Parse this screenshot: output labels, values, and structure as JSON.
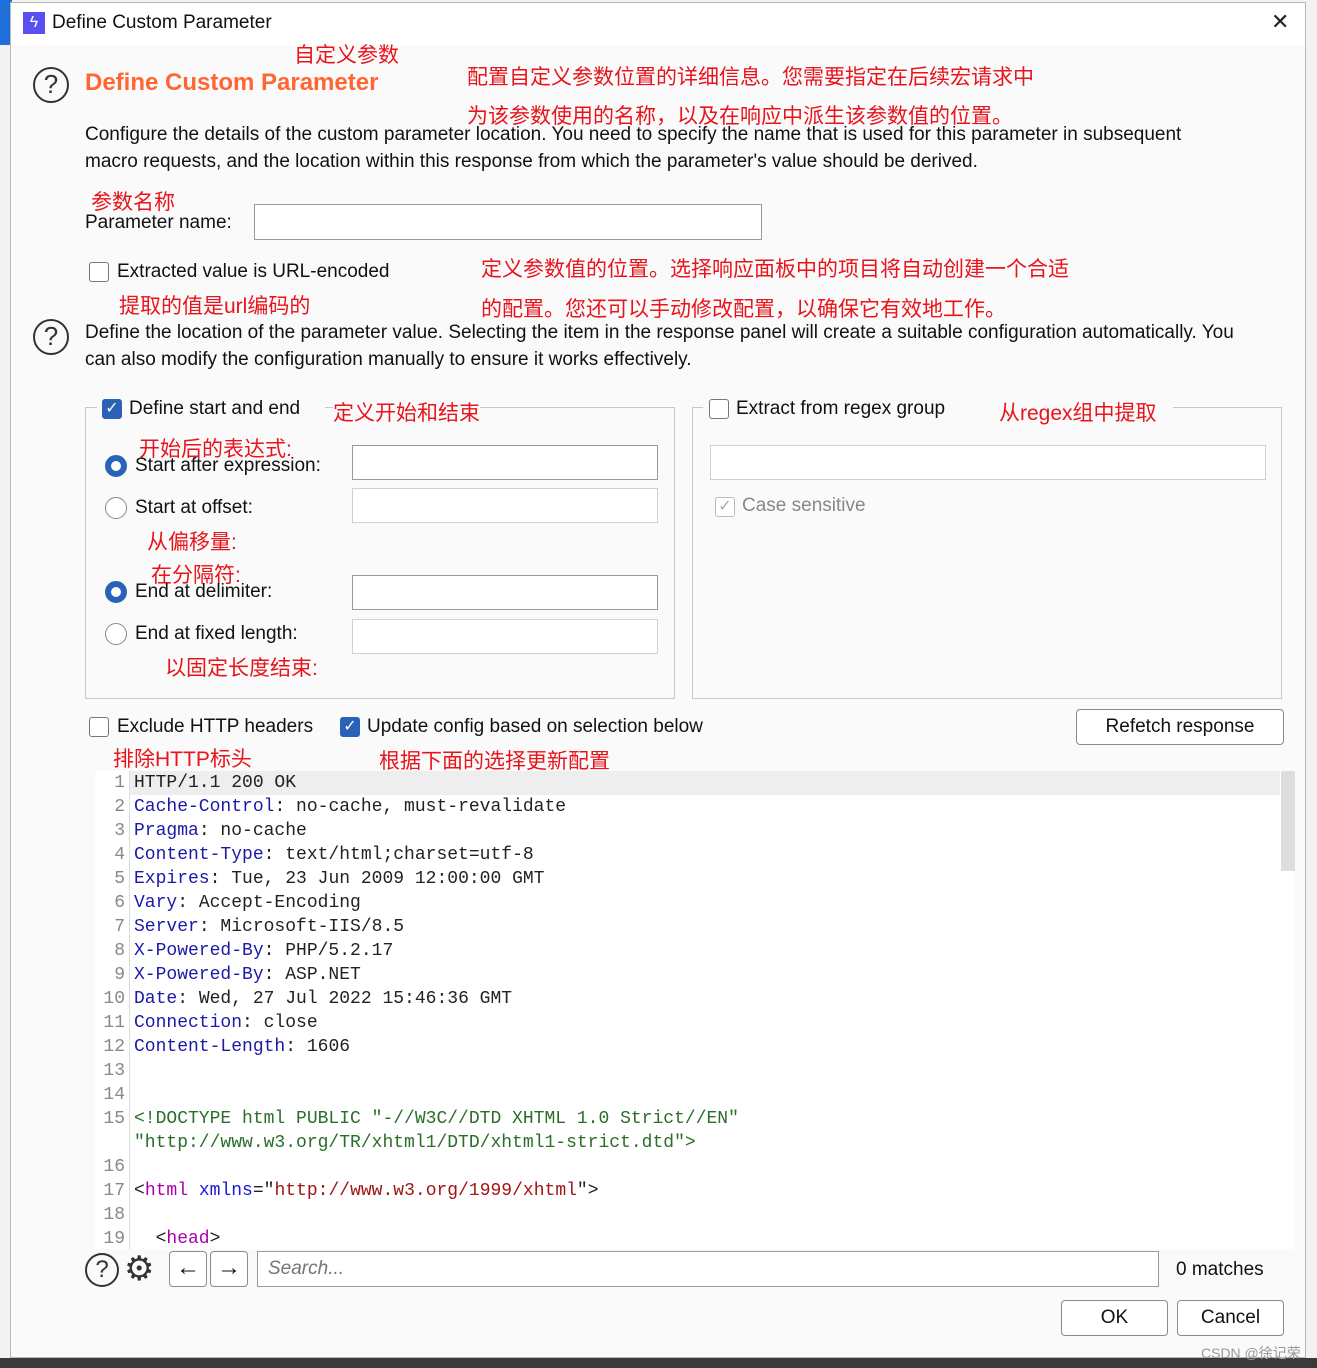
{
  "window": {
    "title": "Define Custom Parameter",
    "close": "✕",
    "app_icon_color": "#5a50f0"
  },
  "header": {
    "title": "Define Custom Parameter",
    "title_color": "#ff6633",
    "description": "Configure the details of the custom parameter location. You need to specify the name that is used for this parameter in subsequent macro requests, and the location within this response from which the parameter's value should be derived."
  },
  "annotations": {
    "title_cn": "自定义参数",
    "desc_cn_1": "配置自定义参数位置的详细信息。您需要指定在后续宏请求中",
    "desc_cn_2": "为该参数使用的名称，以及在响应中派生该参数值的位置。",
    "param_cn": "参数名称",
    "url_cn": "提取的值是url编码的",
    "loc_cn_1": "定义参数值的位置。选择响应面板中的项目将自动创建一个合适",
    "loc_cn_2": "的配置。您还可以手动修改配置，以确保它有效地工作。",
    "start_end_cn": "定义开始和结束",
    "start_after_cn": "开始后的表达式:",
    "offset_cn": "从偏移量:",
    "delim_cn": "在分隔符:",
    "fixed_cn": "以固定长度结束:",
    "regex_cn": "从regex组中提取",
    "exclude_cn": "排除HTTP标头",
    "update_cn": "根据下面的选择更新配置"
  },
  "form": {
    "param_name_label": "Parameter name:",
    "param_name_value": "",
    "url_encoded_label": "Extracted value is URL-encoded",
    "url_encoded_checked": false,
    "location_help": "Define the location of the parameter value. Selecting the item in the response panel will create a suitable configuration automatically. You can also modify the configuration manually to ensure it works effectively.",
    "define_start_end_label": "Define start and end",
    "define_start_end_checked": true,
    "start_after_label": "Start after expression:",
    "start_after_value": "",
    "start_after_selected": true,
    "start_offset_label": "Start at offset:",
    "start_offset_value": "",
    "end_delim_label": "End at delimiter:",
    "end_delim_value": "",
    "end_delim_selected": true,
    "end_fixed_label": "End at fixed length:",
    "end_fixed_value": "",
    "regex_label": "Extract from regex group",
    "regex_checked": false,
    "regex_value": "",
    "case_label": "Case sensitive",
    "case_checked": true,
    "exclude_headers_label": "Exclude HTTP headers",
    "exclude_headers_checked": false,
    "update_config_label": "Update config based on selection below",
    "update_config_checked": true,
    "refetch_label": "Refetch response"
  },
  "code_lines": [
    {
      "n": "1",
      "s": [
        [
          "HTTP/1.1 200 OK",
          ""
        ]
      ]
    },
    {
      "n": "2",
      "s": [
        [
          "Cache-Control",
          "k"
        ],
        [
          ": no-cache, must-revalidate",
          ""
        ]
      ]
    },
    {
      "n": "3",
      "s": [
        [
          "Pragma",
          "k"
        ],
        [
          ": no-cache",
          ""
        ]
      ]
    },
    {
      "n": "4",
      "s": [
        [
          "Content-Type",
          "k"
        ],
        [
          ": text/html;charset=utf-8",
          ""
        ]
      ]
    },
    {
      "n": "5",
      "s": [
        [
          "Expires",
          "k"
        ],
        [
          ": Tue, 23 Jun 2009 12:00:00 GMT",
          ""
        ]
      ]
    },
    {
      "n": "6",
      "s": [
        [
          "Vary",
          "k"
        ],
        [
          ": Accept-Encoding",
          ""
        ]
      ]
    },
    {
      "n": "7",
      "s": [
        [
          "Server",
          "k"
        ],
        [
          ": Microsoft-IIS/8.5",
          ""
        ]
      ]
    },
    {
      "n": "8",
      "s": [
        [
          "X-Powered-By",
          "k"
        ],
        [
          ": PHP/5.2.17",
          ""
        ]
      ]
    },
    {
      "n": "9",
      "s": [
        [
          "X-Powered-By",
          "k"
        ],
        [
          ": ASP.NET",
          ""
        ]
      ]
    },
    {
      "n": "10",
      "s": [
        [
          "Date",
          "k"
        ],
        [
          ": Wed, 27 Jul 2022 15:46:36 GMT",
          ""
        ]
      ]
    },
    {
      "n": "11",
      "s": [
        [
          "Connection",
          "k"
        ],
        [
          ": close",
          ""
        ]
      ]
    },
    {
      "n": "12",
      "s": [
        [
          "Content-Length",
          "k"
        ],
        [
          ": 1606",
          ""
        ]
      ]
    },
    {
      "n": "13",
      "s": []
    },
    {
      "n": "14",
      "s": []
    },
    {
      "n": "15",
      "s": [
        [
          "<!DOCTYPE html PUBLIC \"-//W3C//DTD XHTML 1.0 Strict//EN\"",
          "g"
        ]
      ]
    },
    {
      "n": "",
      "s": [
        [
          "\"http://www.w3.org/TR/xhtml1/DTD/xhtml1-strict.dtd\">",
          "g"
        ]
      ]
    },
    {
      "n": "16",
      "s": []
    },
    {
      "n": "17",
      "s": [
        [
          "<",
          ""
        ],
        [
          "html",
          "m"
        ],
        [
          " ",
          ""
        ],
        [
          "xmlns",
          "b"
        ],
        [
          "=\"",
          ""
        ],
        [
          "http://www.w3.org/1999/xhtml",
          "r"
        ],
        [
          "\">",
          ""
        ]
      ]
    },
    {
      "n": "18",
      "s": []
    },
    {
      "n": "19",
      "s": [
        [
          "  <",
          ""
        ],
        [
          "head",
          "m"
        ],
        [
          ">",
          ""
        ]
      ]
    }
  ],
  "search": {
    "placeholder": "Search...",
    "matches": "0 matches"
  },
  "footer": {
    "ok": "OK",
    "cancel": "Cancel"
  },
  "watermark": "CSDN @徐记荣"
}
